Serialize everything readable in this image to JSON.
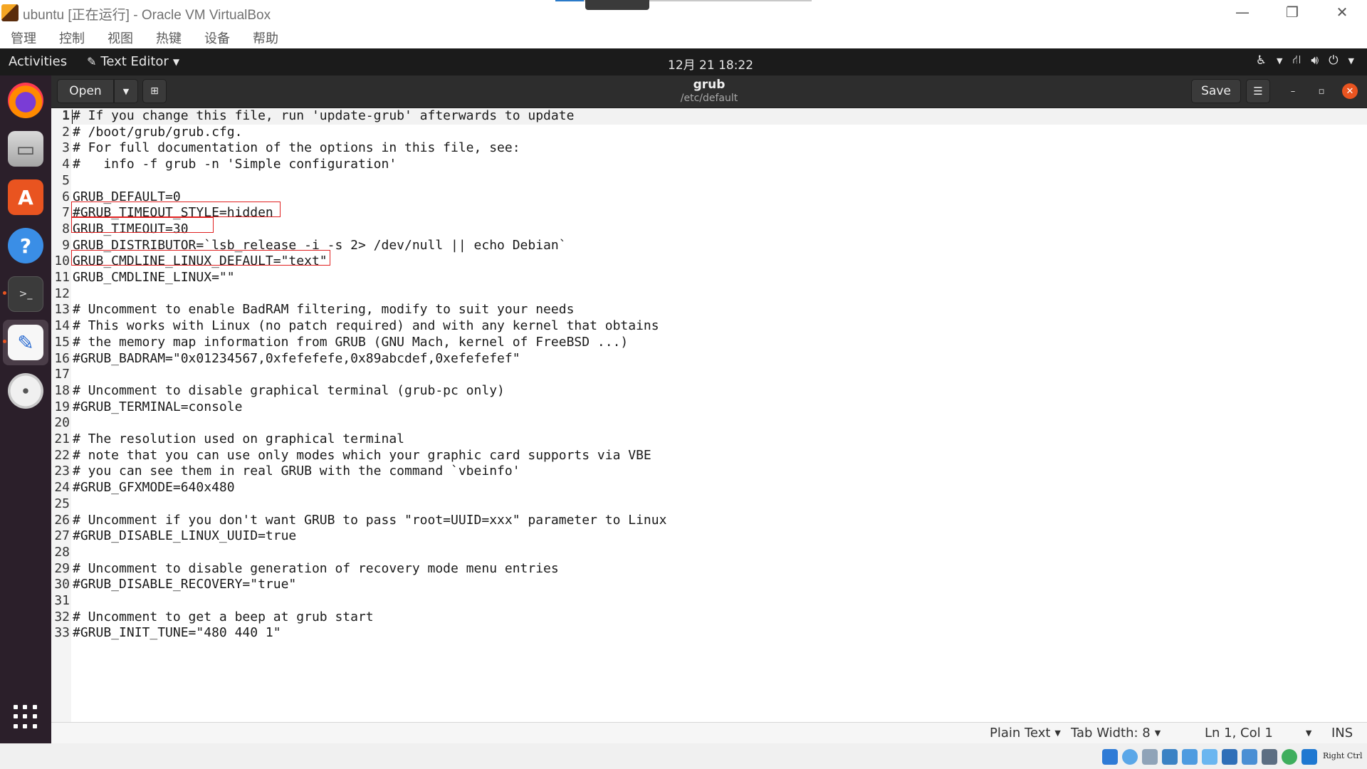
{
  "vbox": {
    "title": "ubuntu [正在运行] - Oracle VM VirtualBox",
    "menu": [
      "管理",
      "控制",
      "视图",
      "热键",
      "设备",
      "帮助"
    ],
    "status_right": "Right Ctrl"
  },
  "topbar": {
    "activities": "Activities",
    "app_name": "Text Editor",
    "clock": "12月 21  18:22"
  },
  "header": {
    "open_label": "Open",
    "save_label": "Save",
    "doc_title": "grub",
    "doc_path": "/etc/default"
  },
  "editor": {
    "current_line": 1,
    "lines": [
      "# If you change this file, run 'update-grub' afterwards to update",
      "# /boot/grub/grub.cfg.",
      "# For full documentation of the options in this file, see:",
      "#   info -f grub -n 'Simple configuration'",
      "",
      "GRUB_DEFAULT=0",
      "#GRUB_TIMEOUT_STYLE=hidden",
      "GRUB_TIMEOUT=30",
      "GRUB_DISTRIBUTOR=`lsb_release -i -s 2> /dev/null || echo Debian`",
      "GRUB_CMDLINE_LINUX_DEFAULT=\"text\"",
      "GRUB_CMDLINE_LINUX=\"\"",
      "",
      "# Uncomment to enable BadRAM filtering, modify to suit your needs",
      "# This works with Linux (no patch required) and with any kernel that obtains",
      "# the memory map information from GRUB (GNU Mach, kernel of FreeBSD ...)",
      "#GRUB_BADRAM=\"0x01234567,0xfefefefe,0x89abcdef,0xefefefef\"",
      "",
      "# Uncomment to disable graphical terminal (grub-pc only)",
      "#GRUB_TERMINAL=console",
      "",
      "# The resolution used on graphical terminal",
      "# note that you can use only modes which your graphic card supports via VBE",
      "# you can see them in real GRUB with the command `vbeinfo'",
      "#GRUB_GFXMODE=640x480",
      "",
      "# Uncomment if you don't want GRUB to pass \"root=UUID=xxx\" parameter to Linux",
      "#GRUB_DISABLE_LINUX_UUID=true",
      "",
      "# Uncomment to disable generation of recovery mode menu entries",
      "#GRUB_DISABLE_RECOVERY=\"true\"",
      "",
      "# Uncomment to get a beep at grub start",
      "#GRUB_INIT_TUNE=\"480 440 1\""
    ],
    "highlighted_lines": [
      7,
      8,
      10
    ],
    "highlight_color": "#e02020"
  },
  "statusbar": {
    "language": "Plain Text",
    "tab_width": "Tab Width: 8",
    "position": "Ln 1, Col 1",
    "mode": "INS"
  },
  "dock": {
    "items": [
      "firefox-icon",
      "files-icon",
      "software-icon",
      "help-icon",
      "terminal-icon",
      "text-editor-icon",
      "cd-icon"
    ]
  },
  "colors": {
    "accent": "#e95420",
    "topbar_bg": "#1b1b1b",
    "dock_bg": "#2b1f2a"
  }
}
